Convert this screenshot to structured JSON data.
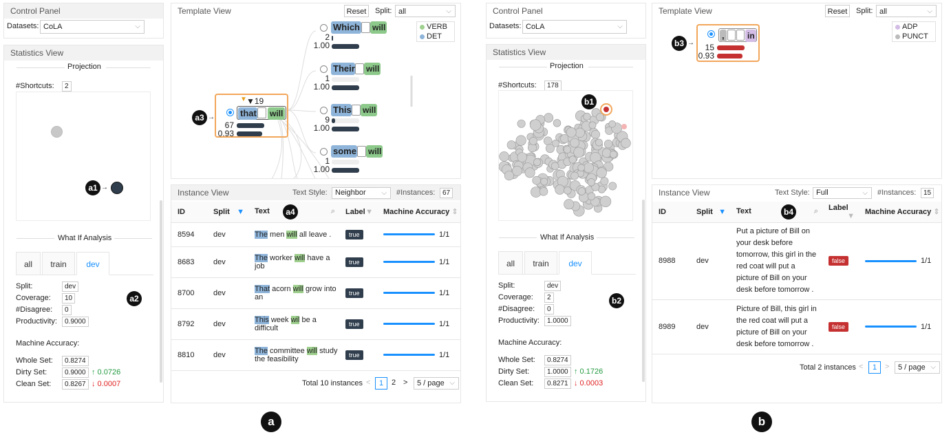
{
  "a": {
    "control_title": "Control Panel",
    "datasets_label": "Datasets:",
    "dataset_value": "CoLA",
    "stats_title": "Statistics View",
    "projection_label": "Projection",
    "shortcuts_label": "#Shortcuts:",
    "shortcuts_value": "2",
    "whatif_label": "What If Analysis",
    "tabs": [
      "all",
      "train",
      "dev"
    ],
    "split_label": "Split:",
    "split_value": "dev",
    "coverage_label": "Coverage:",
    "coverage_value": "10",
    "disagree_label": "#Disagree:",
    "disagree_value": "0",
    "productivity_label": "Productivity:",
    "productivity_value": "0.9000",
    "macc_label": "Machine Accuracy:",
    "whole_label": "Whole Set:",
    "whole_value": "0.8274",
    "dirty_label": "Dirty Set:",
    "dirty_value": "0.9000",
    "dirty_delta": "↑ 0.0726",
    "clean_label": "Clean Set:",
    "clean_value": "0.8267",
    "clean_delta": "↓ 0.0007",
    "template_title": "Template View",
    "reset": "Reset",
    "split_sel_label": "Split:",
    "split_sel_value": "all",
    "legend": [
      "VERB",
      "DET"
    ],
    "nodes": [
      {
        "word": "Which",
        "verb": "will",
        "count": "2",
        "acc": "1.00"
      },
      {
        "word": "Their",
        "verb": "will",
        "count": "1",
        "acc": "1.00"
      },
      {
        "word": "This",
        "verb": "will",
        "count": "9",
        "acc": "1.00"
      },
      {
        "word": "some",
        "verb": "will",
        "count": "1",
        "acc": "1.00"
      }
    ],
    "sel_node": {
      "word": "that",
      "verb": "will",
      "count": "67",
      "acc": "0.93",
      "triangle": "▼19"
    },
    "instance_title": "Instance View",
    "text_style_label": "Text Style:",
    "text_style_value": "Neighbor",
    "ninst_label": "#Instances:",
    "ninst_value": "67",
    "cols": [
      "ID",
      "Split",
      "Text",
      "Label",
      "Machine Accuracy"
    ],
    "rows": [
      {
        "id": "8594",
        "split": "dev",
        "det": "The",
        "mid": " men ",
        "verb": "will",
        "rest": " all leave .",
        "label": "true",
        "acc": "1/1"
      },
      {
        "id": "8683",
        "split": "dev",
        "det": "The",
        "mid": " worker ",
        "verb": "will",
        "rest": " have a job",
        "label": "true",
        "acc": "1/1"
      },
      {
        "id": "8700",
        "split": "dev",
        "det": "That",
        "mid": " acorn ",
        "verb": "will",
        "rest": " grow into an",
        "label": "true",
        "acc": "1/1"
      },
      {
        "id": "8792",
        "split": "dev",
        "det": "This",
        "mid": " week ",
        "verb": "wil",
        "rest": " be a difficult",
        "label": "true",
        "acc": "1/1"
      },
      {
        "id": "8810",
        "split": "dev",
        "det": "The",
        "mid": " committee ",
        "verb": "will",
        "rest": " study the feasibility",
        "label": "true",
        "acc": "1/1"
      }
    ],
    "total": "Total 10 instances",
    "page1": "1",
    "page2": "2",
    "page_size": "5 / page"
  },
  "b": {
    "control_title": "Control Panel",
    "datasets_label": "Datasets:",
    "dataset_value": "CoLA",
    "stats_title": "Statistics View",
    "projection_label": "Projection",
    "shortcuts_label": "#Shortcuts:",
    "shortcuts_value": "178",
    "whatif_label": "What If Analysis",
    "tabs": [
      "all",
      "train",
      "dev"
    ],
    "split_label": "Split:",
    "split_value": "dev",
    "coverage_label": "Coverage:",
    "coverage_value": "2",
    "disagree_label": "#Disagree:",
    "disagree_value": "0",
    "productivity_label": "Productivity:",
    "productivity_value": "1.0000",
    "macc_label": "Machine Accuracy:",
    "whole_label": "Whole Set:",
    "whole_value": "0.8274",
    "dirty_label": "Dirty Set:",
    "dirty_value": "1.0000",
    "dirty_delta": "↑ 0.1726",
    "clean_label": "Clean Set:",
    "clean_value": "0.8271",
    "clean_delta": "↓ 0.0003",
    "template_title": "Template View",
    "reset": "Reset",
    "split_sel_label": "Split:",
    "split_sel_value": "all",
    "legend": [
      "ADP",
      "PUNCT"
    ],
    "sel_node": {
      "punct": ",",
      "adp": "in",
      "count": "15",
      "acc": "0.93"
    },
    "instance_title": "Instance View",
    "text_style_label": "Text Style:",
    "text_style_value": "Full",
    "ninst_label": "#Instances:",
    "ninst_value": "15",
    "cols": [
      "ID",
      "Split",
      "Text",
      "Label",
      "Machine Accuracy"
    ],
    "rows": [
      {
        "id": "8988",
        "split": "dev",
        "text": "Put a picture of Bill on your desk before tomorrow, this girl in the red coat will put a picture of Bill on your desk before tomorrow .",
        "label": "false",
        "acc": "1/1"
      },
      {
        "id": "8989",
        "split": "dev",
        "text": "Picture of Bill, this girl in the red coat will put a picture of Bill on your desk before tomorrow .",
        "label": "false",
        "acc": "1/1"
      }
    ],
    "total": "Total 2 instances",
    "page1": "1",
    "page_size": "5 / page"
  },
  "markers": {
    "a1": "a1",
    "a2": "a2",
    "a3": "a3",
    "a4": "a4",
    "b1": "b1",
    "b2": "b2",
    "b3": "b3",
    "b4": "b4",
    "a": "a",
    "b": "b"
  },
  "colors": {
    "det": "#8eb4d9",
    "verb": "#9fd08e",
    "adp": "#d3bce6",
    "punct": "#bbbbbb",
    "accent": "#1890ff",
    "highlight": "#f2a65a",
    "bar_dark": "#2f3d4c",
    "bar_red": "#c53030"
  }
}
